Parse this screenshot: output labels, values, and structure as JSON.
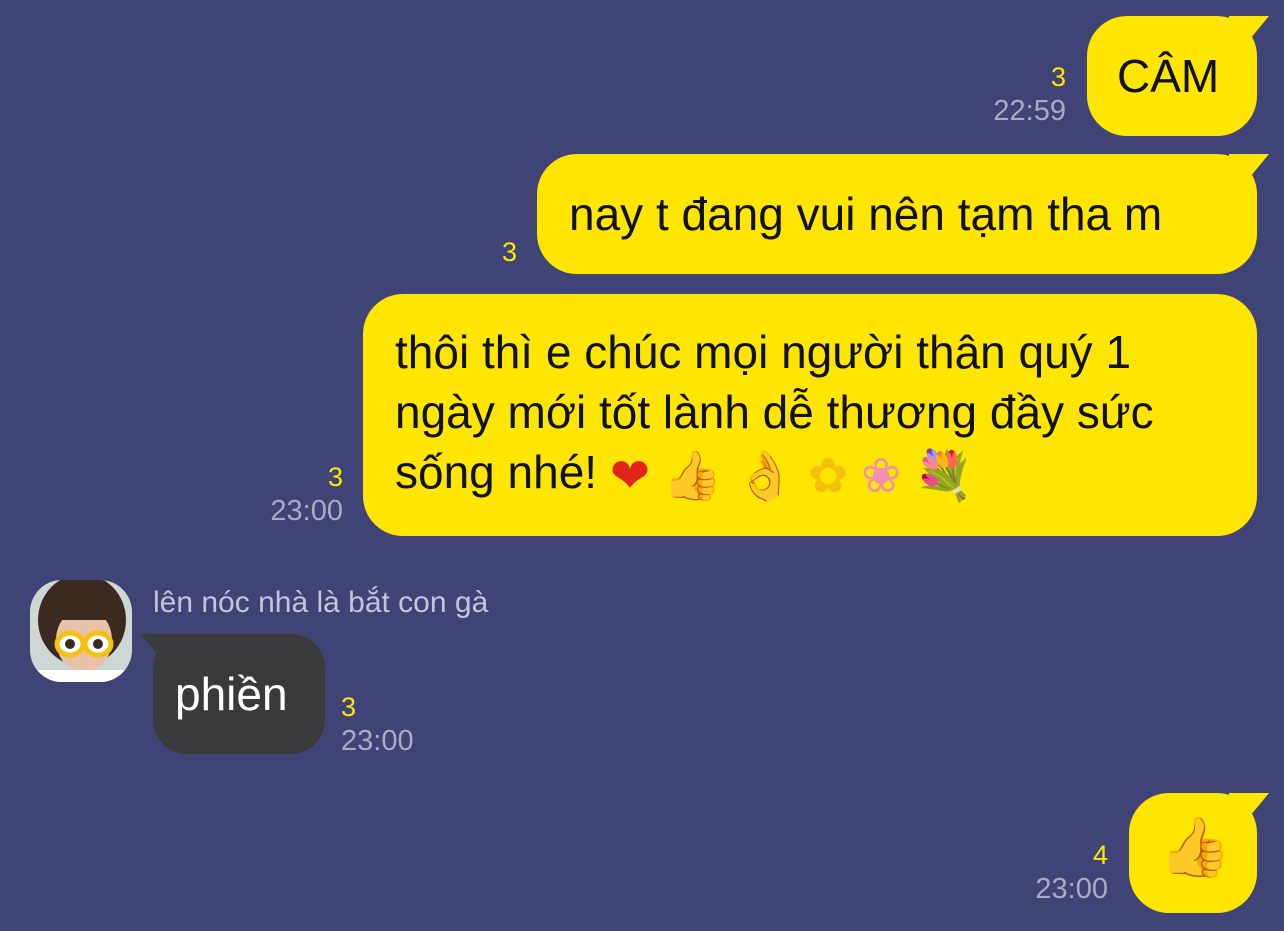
{
  "colors": {
    "background": "#404375",
    "my_bubble": "#ffe600",
    "their_bubble": "#3a3a3c",
    "unread_count": "#ffe600",
    "timestamp": "#a8aac6"
  },
  "messages": [
    {
      "side": "me",
      "text": "CÂM",
      "unread": "3",
      "time": "22:59"
    },
    {
      "side": "me",
      "text": "nay t đang vui nên tạm tha m",
      "unread": "3",
      "time": ""
    },
    {
      "side": "me",
      "text_line1": "thôi thì e chúc mọi người thân quý 1",
      "text_line2": "ngày mới tốt lành dễ thương đầy sức",
      "text_line3": "sống nhé!",
      "emojis": [
        "heart",
        "thumbs-up",
        "ok-hand",
        "sunflower",
        "cherry-blossom",
        "bouquet"
      ],
      "unread": "3",
      "time": "23:00"
    },
    {
      "side": "them",
      "sender": "lên nóc nhà là bắt con gà",
      "text": "phiền",
      "unread": "3",
      "time": "23:00"
    },
    {
      "side": "me",
      "emoji": "thumbs-up",
      "unread": "4",
      "time": "23:00"
    }
  ],
  "glyphs": {
    "heart": "❤",
    "thumbs_up": "👍",
    "ok_hand": "👌",
    "sunflower": "✿",
    "cherry_blossom": "❀",
    "bouquet": "💐"
  }
}
